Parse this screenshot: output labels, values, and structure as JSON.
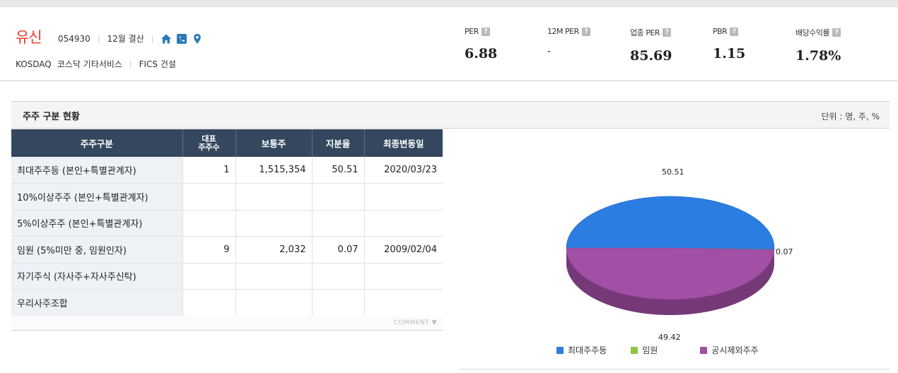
{
  "company": {
    "name": "유신",
    "code": "054930",
    "settlement": "12월 결산",
    "market": "KOSDAQ",
    "sector": "코스닥 기타서비스",
    "fics": "FICS 건설"
  },
  "metrics": [
    {
      "label": "PER",
      "value": "6.88"
    },
    {
      "label": "12M PER",
      "value": "-"
    },
    {
      "label": "업종 PER",
      "value": "85.69"
    },
    {
      "label": "PBR",
      "value": "1.15"
    },
    {
      "label": "배당수익률",
      "value": "1.78%"
    }
  ],
  "section": {
    "title": "주주 구분 현황",
    "unit": "단위 : 명, 주, %",
    "comment": "COMMENT"
  },
  "table": {
    "headers": [
      "주주구분",
      "대표주주수",
      "보통주",
      "지분율",
      "최종변동일"
    ],
    "header_rep_line1": "대표",
    "header_rep_line2": "주주수",
    "rows": [
      {
        "label": "최대주주등 (본인+특별관계자)",
        "count": "1",
        "shares": "1,515,354",
        "ratio": "50.51",
        "date": "2020/03/23"
      },
      {
        "label": "10%이상주주 (본인+특별관계자)",
        "count": "",
        "shares": "",
        "ratio": "",
        "date": ""
      },
      {
        "label": "5%이상주주 (본인+특별관계자)",
        "count": "",
        "shares": "",
        "ratio": "",
        "date": ""
      },
      {
        "label": "임원 (5%미만 중, 임원인자)",
        "count": "9",
        "shares": "2,032",
        "ratio": "0.07",
        "date": "2009/02/04"
      },
      {
        "label": "자기주식 (자사주+자사주신탁)",
        "count": "",
        "shares": "",
        "ratio": "",
        "date": ""
      },
      {
        "label": "우리사주조합",
        "count": "",
        "shares": "",
        "ratio": "",
        "date": ""
      }
    ]
  },
  "chart_data": {
    "type": "pie",
    "categories": [
      "최대주주등",
      "임원",
      "공시제외주주"
    ],
    "values": [
      50.51,
      0.07,
      49.42
    ],
    "colors": [
      "#2b7de1",
      "#8cc63e",
      "#a24fa6"
    ],
    "data_labels": [
      "50.51",
      "0.07",
      "49.42"
    ],
    "legend_position": "bottom",
    "style": "3d"
  }
}
